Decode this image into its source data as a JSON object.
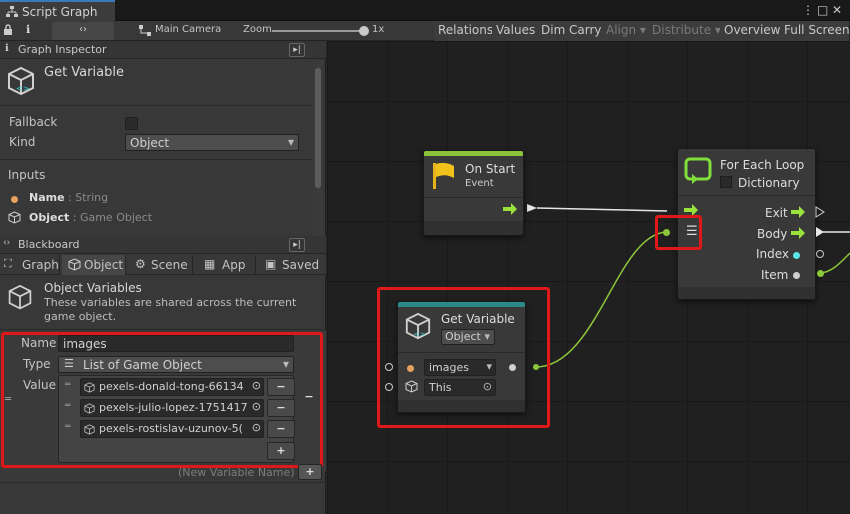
{
  "window": {
    "tab_title": "Script Graph"
  },
  "toolbar": {
    "camera": "Main Camera",
    "zoom_label": "Zoom",
    "zoom_value": "1x",
    "zoom_level": 1.0,
    "buttons": [
      "Relations",
      "Values",
      "Dim",
      "Carry",
      "Align",
      "Distribute",
      "Overview",
      "Full Screen"
    ],
    "disabled": [
      "Align",
      "Distribute"
    ]
  },
  "inspector": {
    "header": "Graph Inspector",
    "node_title": "Get Variable",
    "fallback_label": "Fallback",
    "kind_label": "Kind",
    "kind_value": "Object",
    "inputs_header": "Inputs",
    "inputs": [
      {
        "name": "Name",
        "sep": " : ",
        "type": "String"
      },
      {
        "name": "Object",
        "sep": " : ",
        "type": "Game Object"
      }
    ]
  },
  "blackboard": {
    "header": "Blackboard",
    "tabs": [
      "Graph",
      "Object",
      "Scene",
      "App",
      "Saved"
    ],
    "section_title": "Object Variables",
    "description": "These variables are shared across the current game object.",
    "name_label": "Name",
    "name_value": "images",
    "type_label": "Type",
    "type_value": "List of Game Object",
    "value_label": "Value",
    "items": [
      "pexels-donald-tong-66134",
      "pexels-julio-lopez-1751417",
      "pexels-rostislav-uzunov-5("
    ],
    "add_label": "+",
    "new_var_placeholder": "(New Variable Name)"
  },
  "nodes": {
    "on_start": {
      "title": "On Start",
      "subtitle": "Event"
    },
    "for_each": {
      "title": "For Each Loop",
      "dict_label": "Dictionary",
      "exit": "Exit",
      "body": "Body",
      "index": "Index",
      "item": "Item"
    },
    "get_var": {
      "title": "Get Variable",
      "kind": "Object",
      "name_value": "images",
      "target_value": "This"
    }
  },
  "colors": {
    "accent": "#3a79bb",
    "flow": "#9be33a",
    "highlight": "#e01818",
    "event_header": "#8ac33a",
    "var_header": "#2a8a8a"
  }
}
